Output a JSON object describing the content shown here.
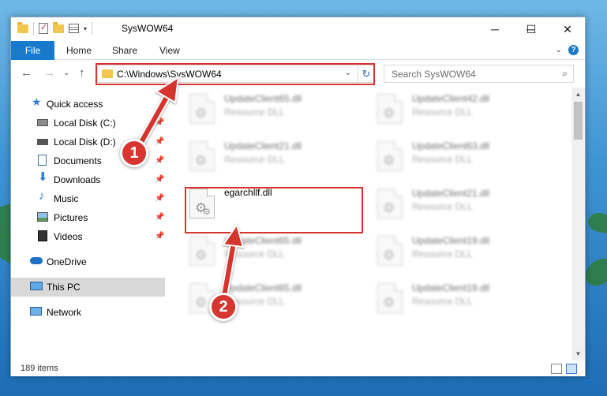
{
  "window": {
    "title": "SysWOW64",
    "minimize_glyph": "─",
    "maximize_glyph": "☐",
    "close_glyph": "✕"
  },
  "ribbon": {
    "tabs": [
      "File",
      "Home",
      "Share",
      "View"
    ]
  },
  "nav": {
    "back_glyph": "←",
    "forward_glyph": "→",
    "recent_glyph": "⌄",
    "up_glyph": "↑",
    "address": "C:\\Windows\\SysWOW64",
    "search_placeholder": "Search SysWOW64"
  },
  "sidebar": {
    "items": [
      {
        "label": "Quick access",
        "icon": "star-icon",
        "pinned": false
      },
      {
        "label": "Local Disk (C:)",
        "icon": "drive-icon",
        "pinned": true
      },
      {
        "label": "Local Disk (D:)",
        "icon": "drive-icon",
        "pinned": true
      },
      {
        "label": "Documents",
        "icon": "documents-icon",
        "pinned": true
      },
      {
        "label": "Downloads",
        "icon": "download-icon",
        "pinned": true
      },
      {
        "label": "Music",
        "icon": "music-icon",
        "pinned": true
      },
      {
        "label": "Pictures",
        "icon": "pictures-icon",
        "pinned": true
      },
      {
        "label": "Videos",
        "icon": "videos-icon",
        "pinned": true
      },
      {
        "label": "OneDrive",
        "icon": "cloud-icon",
        "pinned": false
      },
      {
        "label": "This PC",
        "icon": "computer-icon",
        "pinned": false
      },
      {
        "label": "Network",
        "icon": "network-icon",
        "pinned": false
      }
    ]
  },
  "files": {
    "left": [
      {
        "name": "UpdateClient65.dll",
        "type": "Resource DLL"
      },
      {
        "name": "UpdateClient21.dll",
        "type": "Resource DLL"
      },
      {
        "name": "egarchllf.dll",
        "type": ""
      },
      {
        "name": "UpdateClient65.dll",
        "type": "Resource DLL"
      },
      {
        "name": "UpdateClient65.dll",
        "type": "Resource DLL"
      }
    ],
    "right": [
      {
        "name": "UpdateClient42.dll",
        "type": "Resource DLL"
      },
      {
        "name": "UpdateClient63.dll",
        "type": "Resource DLL"
      },
      {
        "name": "UpdateClient21.dll",
        "type": "Resource DLL"
      },
      {
        "name": "UpdateClient19.dll",
        "type": "Resource DLL"
      },
      {
        "name": "UpdateClient19.dll",
        "type": "Resource DLL"
      }
    ]
  },
  "status": {
    "item_count": "189 items"
  },
  "callouts": [
    "1",
    "2"
  ],
  "colors": {
    "accent": "#1979ca",
    "highlight": "#d6362f"
  }
}
